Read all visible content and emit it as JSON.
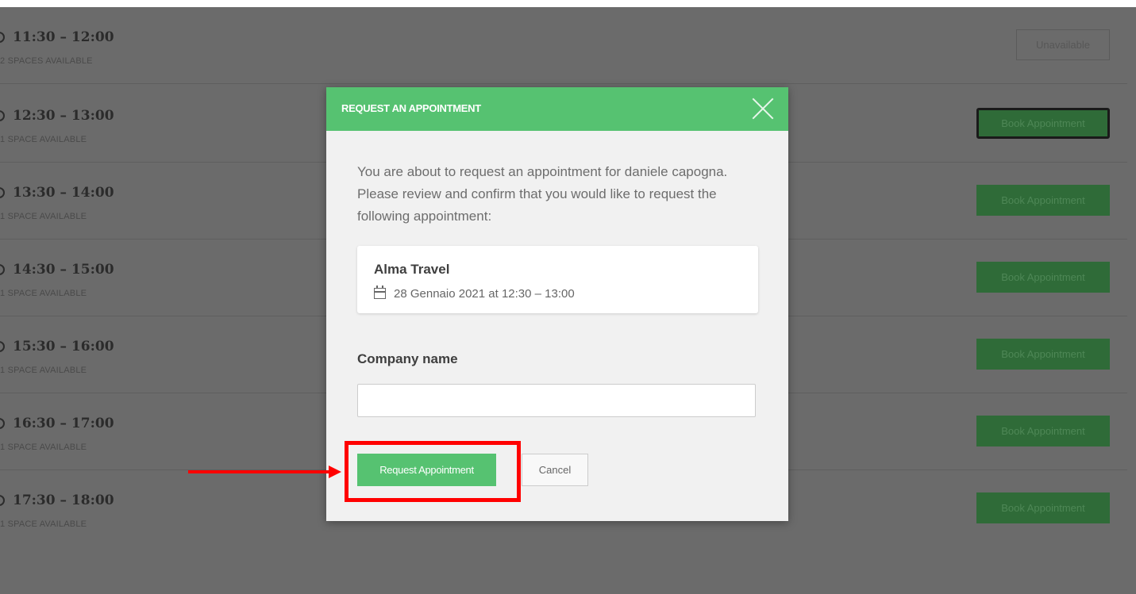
{
  "slots": [
    {
      "time": "11:30 – 12:00",
      "availability": "2 SPACES AVAILABLE",
      "button": "Unavailable",
      "state": "unavailable"
    },
    {
      "time": "12:30 – 13:00",
      "availability": "1 SPACE AVAILABLE",
      "button": "Book Appointment",
      "state": "focused"
    },
    {
      "time": "13:30 – 14:00",
      "availability": "1 SPACE AVAILABLE",
      "button": "Book Appointment",
      "state": "available"
    },
    {
      "time": "14:30 – 15:00",
      "availability": "1 SPACE AVAILABLE",
      "button": "Book Appointment",
      "state": "available"
    },
    {
      "time": "15:30 – 16:00",
      "availability": "1 SPACE AVAILABLE",
      "button": "Book Appointment",
      "state": "available"
    },
    {
      "time": "16:30 – 17:00",
      "availability": "1 SPACE AVAILABLE",
      "button": "Book Appointment",
      "state": "available"
    },
    {
      "time": "17:30 – 18:00",
      "availability": "1 SPACE AVAILABLE",
      "button": "Book Appointment",
      "state": "available"
    }
  ],
  "modal": {
    "title": "REQUEST AN APPOINTMENT",
    "intro": "You are about to request an appointment for daniele capogna. Please review and confirm that you would like to request the following appointment:",
    "card": {
      "name": "Alma Travel",
      "date": "28 Gennaio 2021 at 12:30 – 13:00"
    },
    "company_label": "Company name",
    "company_value": "",
    "request_label": "Request Appointment",
    "cancel_label": "Cancel"
  },
  "colors": {
    "accent": "#56c271",
    "annotation": "#ff0000"
  },
  "icons": [
    "clock-icon",
    "close-icon",
    "calendar-icon"
  ]
}
